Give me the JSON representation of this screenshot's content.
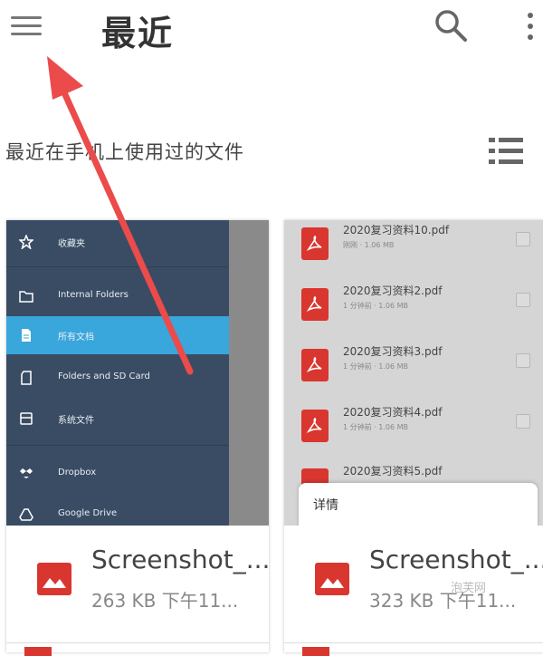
{
  "header": {
    "title": "最近",
    "menu_icon": "hamburger-menu-icon",
    "search_icon": "search-icon",
    "more_icon": "more-vert-icon"
  },
  "section": {
    "label": "最近在手机上使用过的文件",
    "view_toggle_icon": "list-view-icon"
  },
  "cards": [
    {
      "file_name": "Screenshot_...",
      "file_meta": "263 KB 下午11...",
      "file_icon": "image-icon",
      "drawer_items": [
        {
          "label": "收藏夹",
          "icon": "star-icon"
        },
        {
          "label": "Internal Folders",
          "icon": "folder-icon"
        },
        {
          "label": "所有文档",
          "icon": "document-icon"
        },
        {
          "label": "Folders and SD Card",
          "icon": "sd-card-icon"
        },
        {
          "label": "系统文件",
          "icon": "system-files-icon"
        },
        {
          "label": "Dropbox",
          "icon": "dropbox-icon"
        },
        {
          "label": "Google Drive",
          "icon": "google-drive-icon"
        }
      ]
    },
    {
      "file_name": "Screenshot_...",
      "file_meta": "323 KB 下午11...",
      "file_icon": "image-icon",
      "files": [
        {
          "name": "2020复习资料10.pdf",
          "meta": "刚刚 · 1.06 MB"
        },
        {
          "name": "2020复习资料2.pdf",
          "meta": "1 分钟前 · 1.06 MB"
        },
        {
          "name": "2020复习资料3.pdf",
          "meta": "1 分钟前 · 1.06 MB"
        },
        {
          "name": "2020复习资料4.pdf",
          "meta": "1 分钟前 · 1.06 MB"
        },
        {
          "name": "2020复习资料5.pdf",
          "meta": ""
        }
      ],
      "popup_label": "详情"
    }
  ],
  "watermark": "泡芙网",
  "colors": {
    "accent": "#39a6dc",
    "drawer_bg": "#3a4c63",
    "pdf_red": "#d9362f",
    "arrow_red": "#ec4b4b"
  }
}
